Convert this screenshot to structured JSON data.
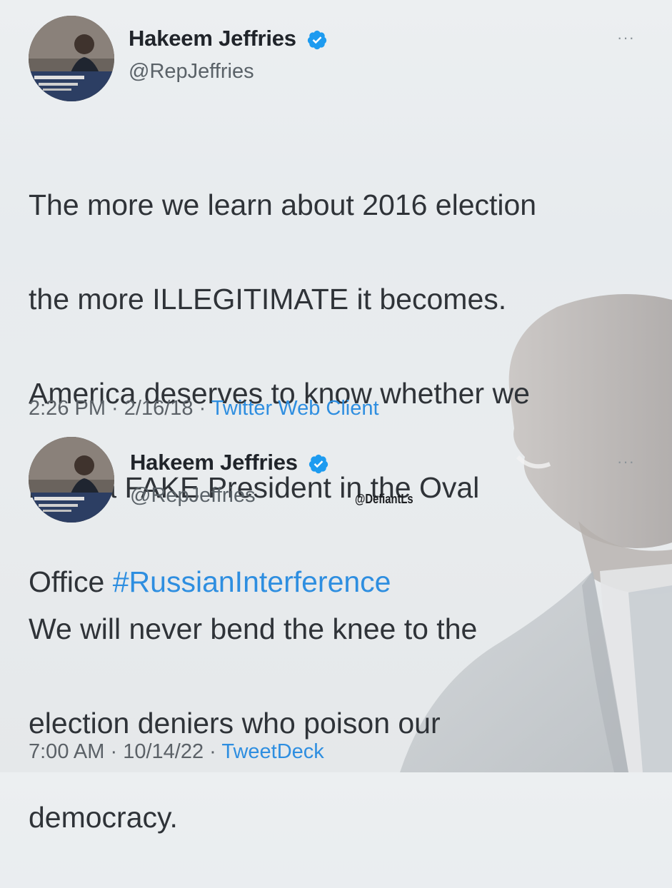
{
  "tweets": [
    {
      "display_name": "Hakeem Jeffries",
      "handle": "@RepJeffries",
      "text_lines": [
        "The more we learn about 2016 election",
        "the more ILLEGITIMATE it becomes.",
        "America deserves to know whether we",
        "have a FAKE President in the Oval"
      ],
      "text_last_prefix": "Office ",
      "hashtag": "#RussianInterference",
      "time": "2:26 PM",
      "date": "2/16/18",
      "source": "Twitter Web Client",
      "more_icon": "···"
    },
    {
      "display_name": "Hakeem Jeffries",
      "handle": "@RepJeffries",
      "text_lines": [
        "We will never bend the knee to the",
        "election deniers who poison our",
        "democracy."
      ],
      "time": "7:00 AM",
      "date": "10/14/22",
      "source": "TweetDeck",
      "more_icon": "···"
    }
  ],
  "meta_separator": " · ",
  "watermark": "@DefiantLs",
  "colors": {
    "link": "#2e8ee0",
    "verified": "#1d9bf0"
  }
}
